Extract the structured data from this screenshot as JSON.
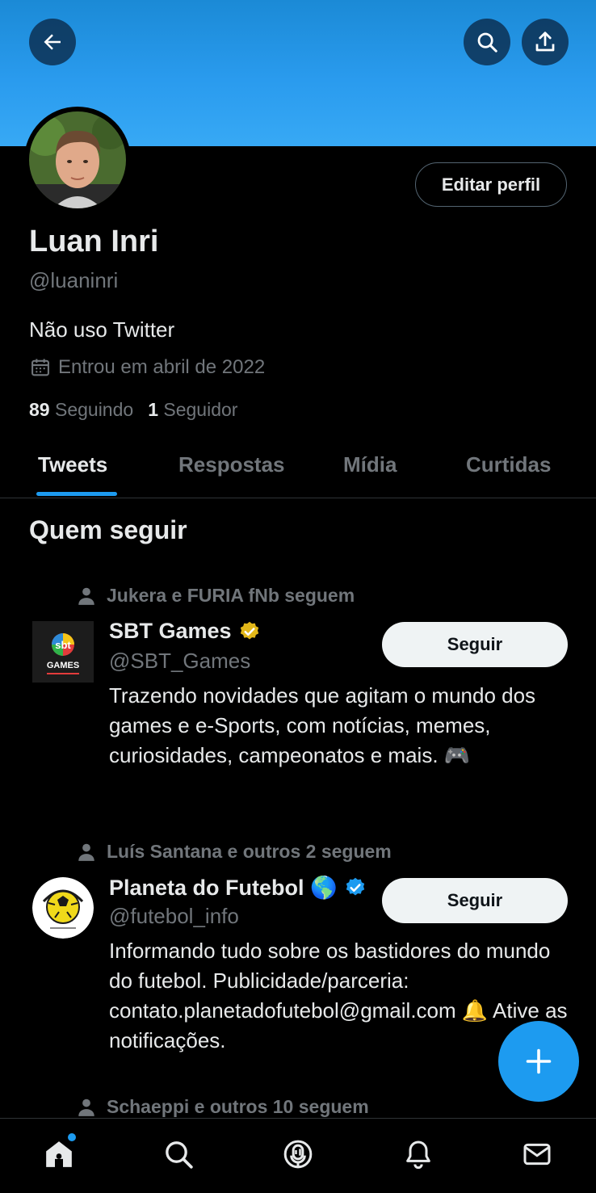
{
  "profile": {
    "name": "Luan Inri",
    "handle": "@luaninri",
    "bio": "Não uso Twitter",
    "joined": "Entrou em abril de 2022",
    "following_count": "89",
    "following_label": "Seguindo",
    "followers_count": "1",
    "followers_label": "Seguidor",
    "edit_label": "Editar perfil"
  },
  "header_icons": [
    "back-arrow-icon",
    "search-icon",
    "share-icon"
  ],
  "tabs": [
    {
      "label": "Tweets",
      "active": true
    },
    {
      "label": "Respostas",
      "active": false
    },
    {
      "label": "Mídia",
      "active": false
    },
    {
      "label": "Curtidas",
      "active": false
    }
  ],
  "who_to_follow": {
    "title": "Quem seguir",
    "suggestions": [
      {
        "social_context": "Jukera e FURIA fNb seguem",
        "name": "SBT Games",
        "handle": "@SBT_Games",
        "verified": "gold",
        "bio": "Trazendo novidades que agitam o mundo dos games e e-Sports, com notícias, memes, curiosidades, campeonatos e mais. 🎮",
        "follow_label": "Seguir",
        "avatar_text_top": "sbt",
        "avatar_text_bottom": "GAMES"
      },
      {
        "social_context": "Luís Santana e outros 2 seguem",
        "name": "Planeta do Futebol 🌎",
        "handle": "@futebol_info",
        "verified": "blue",
        "bio": "Informando tudo sobre os bastidores do mundo do futebol. Publicidade/parceria: contato.planetadofutebol@gmail.com 🔔 Ative as notificações.",
        "follow_label": "Seguir"
      },
      {
        "social_context": "Schaeppi e outros 10 seguem"
      }
    ]
  },
  "bottom_nav": [
    "home-icon",
    "search-icon",
    "spaces-icon",
    "notifications-icon",
    "messages-icon"
  ],
  "colors": {
    "accent": "#1d9bf0",
    "background": "#000000",
    "text_primary": "#e7e9ea",
    "text_secondary": "#71767b",
    "verified_gold": "#e2b719"
  }
}
